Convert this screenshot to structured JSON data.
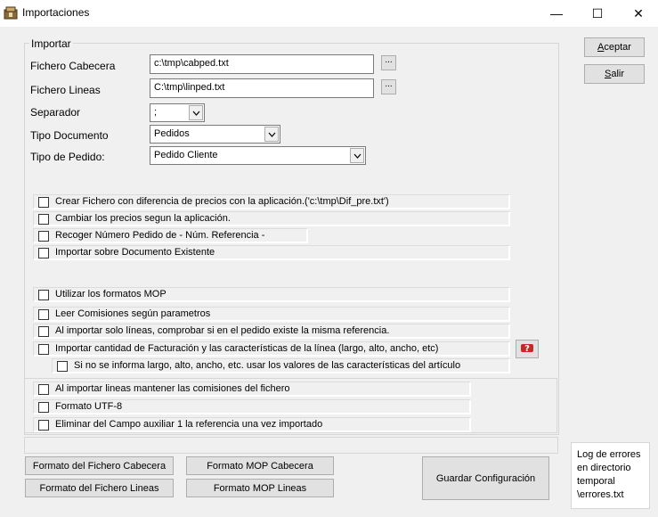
{
  "window": {
    "title": "Importaciones",
    "minimize": "—",
    "maximize": "☐",
    "close": "✕"
  },
  "group": {
    "legend": "Importar"
  },
  "fields": {
    "cabecera": {
      "label": "Fichero Cabecera",
      "value": "c:\\tmp\\cabped.txt",
      "browse": "..."
    },
    "lineas": {
      "label": "Fichero Lineas",
      "value": "C:\\tmp\\linped.txt",
      "browse": "..."
    },
    "separador": {
      "label": "Separador",
      "value": ";"
    },
    "tipo_documento": {
      "label": "Tipo Documento",
      "value": "Pedidos"
    },
    "tipo_pedido": {
      "label": "Tipo de Pedido:",
      "value": "Pedido Cliente"
    }
  },
  "options1": [
    "Crear Fichero con diferencia de precios con la aplicación.('c:\\tmp\\Dif_pre.txt')",
    "Cambiar los precios segun la aplicación.",
    "Recoger Número Pedido de - Núm. Referencia -",
    "Importar sobre Documento Existente"
  ],
  "options2": [
    "Utilizar los formatos MOP",
    "Leer Comisiones según parametros",
    "Al importar solo líneas, comprobar si en el pedido existe la misma referencia.",
    "Importar cantidad de Facturación y las características de la línea (largo, alto, ancho, etc)",
    "Si no se informa largo, alto, ancho, etc. usar los valores de las características del artículo"
  ],
  "options3": [
    "Al importar lineas mantener las comisiones del fichero",
    "Formato UTF-8",
    "Eliminar del Campo auxiliar 1 la referencia una vez importado"
  ],
  "side_buttons": {
    "aceptar_first": "A",
    "aceptar_rest": "ceptar",
    "salir_first": "S",
    "salir_rest": "alir"
  },
  "bottom_buttons": {
    "formato_cabecera": "Formato del Fichero Cabecera",
    "formato_lineas": "Formato del Fichero Lineas",
    "mop_cabecera": "Formato MOP Cabecera",
    "mop_lineas": "Formato MOP Lineas",
    "guardar": "Guardar Configuración"
  },
  "log": {
    "line1": "Log de errores",
    "line2": "en directorio",
    "line3": "temporal",
    "line4": "\\errores.txt"
  },
  "icons": {
    "app": "import-app-icon",
    "help": "help-question-icon"
  }
}
